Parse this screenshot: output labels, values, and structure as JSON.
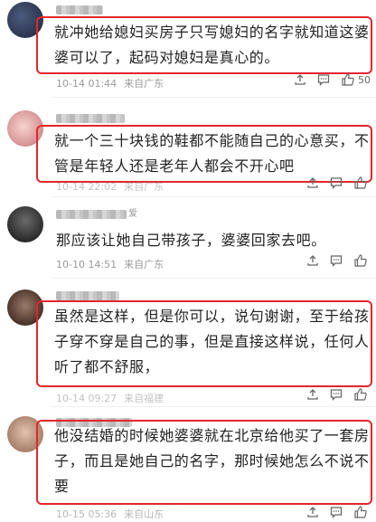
{
  "comments": [
    {
      "username_suffix": "",
      "text_lines": [
        "就冲她给媳妇买房子只写媳妇的名字就知道这婆",
        "婆可以了，起码对媳妇是真心的。"
      ],
      "timestamp": "10-14 01:44",
      "location": "来自广东",
      "likes": "50",
      "icons": [
        "share-icon",
        "comment-icon",
        "like-icon"
      ],
      "avatar_color": "#2b3550"
    },
    {
      "username_suffix": "",
      "text_lines": [
        "就一个三十块钱的鞋都不能随自己的心意买，不",
        "管是年轻人还是老年人都会不开心吧"
      ],
      "timestamp": "10-14 22:02",
      "location": "来自广东",
      "likes": "",
      "icons": [
        "share-icon",
        "comment-icon",
        "like-icon"
      ],
      "avatar_color": "#e8b7b7"
    },
    {
      "username_suffix": "爱",
      "text_lines": [
        "那应该让她自己带孩子，婆婆回家去吧。"
      ],
      "timestamp": "10-10 14:51",
      "location": "来自广东",
      "likes": "",
      "icons": [
        "share-icon",
        "comment-icon",
        "like-icon"
      ],
      "avatar_color": "#3a3a3a"
    },
    {
      "username_suffix": "",
      "text_lines": [
        "虽然是这样，但是你可以，说句谢谢，至于给孩",
        "子穿不穿是自己的事，但是直接这样说，任何人",
        "听了都不舒服，"
      ],
      "timestamp": "10-14 09:27",
      "location": "来自福建",
      "likes": "",
      "icons": [
        "share-icon",
        "comment-icon",
        "like-icon"
      ],
      "avatar_color": "#6b4a3a"
    },
    {
      "username_suffix": "",
      "text_lines": [
        "他没结婚的时候她婆婆就在北京给他买了一套房",
        "子，而且是她自己的名字，那时候她怎么不说不",
        "要"
      ],
      "timestamp": "10-15 05:36",
      "location": "来自山东",
      "likes": "",
      "icons": [
        "share-icon",
        "comment-icon",
        "like-icon"
      ],
      "avatar_color": "#c9a08a"
    }
  ]
}
